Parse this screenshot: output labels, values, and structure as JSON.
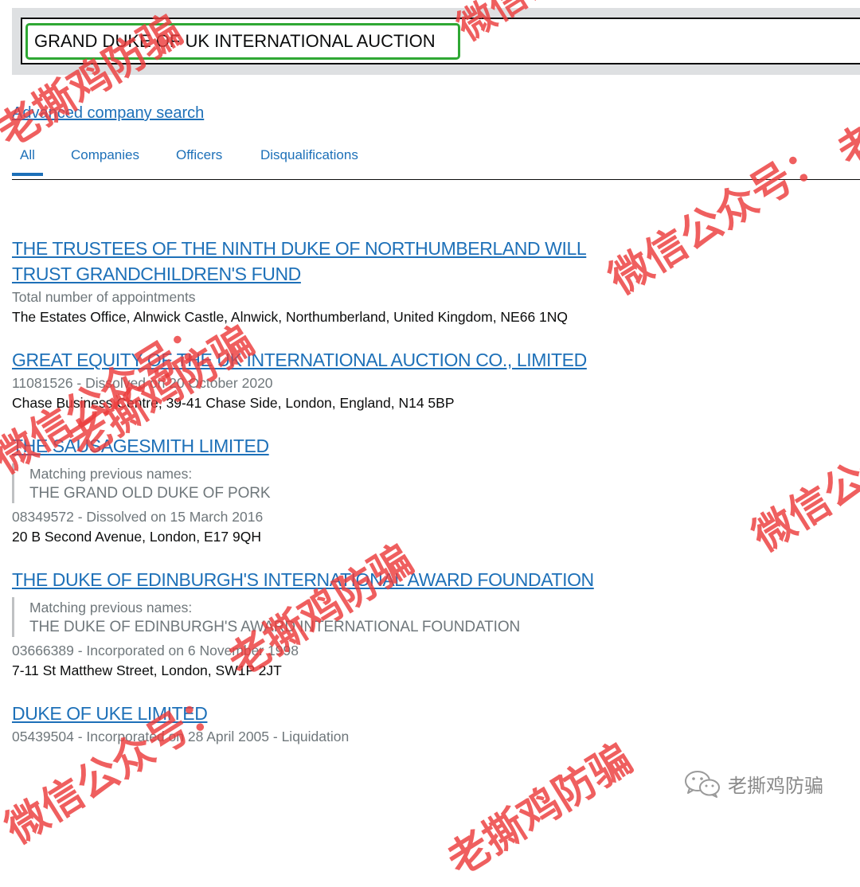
{
  "search": {
    "value": "GRAND DUKE OF UK INTERNATIONAL AUCTION"
  },
  "advanced_link": "Advanced company search",
  "tabs": [
    {
      "label": "All",
      "active": true
    },
    {
      "label": "Companies"
    },
    {
      "label": "Officers"
    },
    {
      "label": "Disqualifications"
    }
  ],
  "results": [
    {
      "title": "THE TRUSTEES OF THE NINTH DUKE OF NORTHUMBERLAND WILL TRUST GRANDCHILDREN'S FUND",
      "meta": "Total number of appointments",
      "address": "The Estates Office, Alnwick Castle, Alnwick, Northumberland, United Kingdom, NE66 1NQ"
    },
    {
      "title": "GREAT EQUITY OF THE UK INTERNATIONAL AUCTION CO., LIMITED",
      "meta": "11081526 - Dissolved on 20 October 2020",
      "address": "Chase Business Centre, 39-41 Chase Side, London, England, N14 5BP"
    },
    {
      "title": "THE SAUSAGESMITH LIMITED",
      "previous_label": "Matching previous names:",
      "previous_name": "THE GRAND OLD DUKE OF PORK",
      "meta": "08349572 - Dissolved on 15 March 2016",
      "address": "20 B Second Avenue, London, E17 9QH"
    },
    {
      "title": "THE DUKE OF EDINBURGH'S INTERNATIONAL AWARD FOUNDATION",
      "previous_label": "Matching previous names:",
      "previous_name": "THE DUKE OF EDINBURGH'S AWARD INTERNATIONAL FOUNDATION",
      "meta": "03666389 - Incorporated on 6 November 1998",
      "address": "7-11 St Matthew Street, London, SW1P 2JT"
    },
    {
      "title": "DUKE OF UKE LIMITED",
      "meta": "05439504 - Incorporated on 28 April 2005 - Liquidation"
    }
  ],
  "watermark": {
    "account_label": "微信公众号：",
    "name": "老撕鸡防骗",
    "color": "#eb3c3c",
    "logo_icon": "wechat-icon"
  }
}
